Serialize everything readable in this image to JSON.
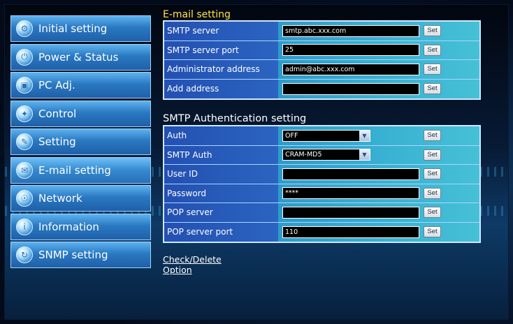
{
  "sidebar": {
    "items": [
      {
        "label": "Initial setting",
        "icon": "initial-setting-icon"
      },
      {
        "label": "Power & Status",
        "icon": "power-status-icon"
      },
      {
        "label": "PC Adj.",
        "icon": "pc-adj-icon"
      },
      {
        "label": "Control",
        "icon": "control-icon"
      },
      {
        "label": "Setting",
        "icon": "setting-icon"
      },
      {
        "label": "E-mail setting",
        "icon": "email-icon"
      },
      {
        "label": "Network",
        "icon": "network-icon"
      },
      {
        "label": "Information",
        "icon": "information-icon"
      },
      {
        "label": "SNMP setting",
        "icon": "snmp-icon"
      }
    ]
  },
  "email": {
    "title": "E-mail setting",
    "rows": [
      {
        "label": "SMTP server",
        "value": "smtp.abc.xxx.com"
      },
      {
        "label": "SMTP server port",
        "value": "25"
      },
      {
        "label": "Administrator address",
        "value": "admin@abc.xxx.com"
      },
      {
        "label": "Add address",
        "value": ""
      }
    ]
  },
  "auth": {
    "title": "SMTP Authentication setting",
    "rows": [
      {
        "label": "Auth",
        "value": "OFF",
        "type": "select"
      },
      {
        "label": "SMTP Auth",
        "value": "CRAM-MD5",
        "type": "select"
      },
      {
        "label": "User ID",
        "value": ""
      },
      {
        "label": "Password",
        "value": "****"
      },
      {
        "label": "POP server",
        "value": ""
      },
      {
        "label": "POP server port",
        "value": "110"
      }
    ]
  },
  "set_label": "Set",
  "links": {
    "check_delete": "Check/Delete",
    "option": "Option"
  },
  "colors": {
    "title_accent": "#ffe34a",
    "label_bg": "#2350b2",
    "field_bg": "#3bb4d3"
  }
}
